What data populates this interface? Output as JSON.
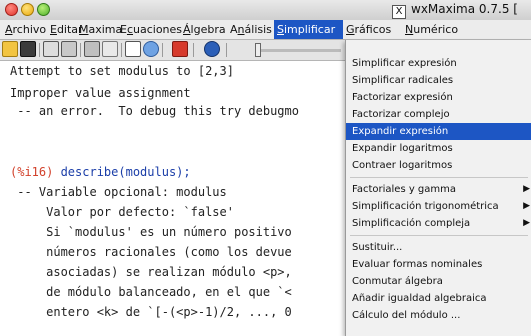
{
  "window": {
    "title": "wxMaxima 0.7.5 [",
    "x_icon": "X"
  },
  "menubar": [
    {
      "label": "Archivo",
      "mn": "A",
      "rest": "rchivo"
    },
    {
      "label": "Editar",
      "mn": "E",
      "rest": "ditar"
    },
    {
      "label": "Maxima",
      "mn": "M",
      "rest": "axima"
    },
    {
      "label": "Ecuaciones",
      "pre": "E",
      "mn": "c",
      "rest": "uaciones"
    },
    {
      "label": "Álgebra",
      "mn": "Á",
      "rest": "lgebra"
    },
    {
      "label": "Análisis",
      "pre": "A",
      "mn": "n",
      "rest": "álisis"
    },
    {
      "label": "Simplificar",
      "mn": "S",
      "rest": "implificar",
      "active": true
    },
    {
      "label": "Gráficos",
      "mn": "G",
      "rest": "ráficos"
    },
    {
      "label": "Numérico",
      "mn": "N",
      "rest": "umérico"
    }
  ],
  "toolbar_icons": [
    "open-folder-icon",
    "save-icon",
    "print-icon",
    "preferences-icon",
    "copy-icon",
    "cut-icon",
    "select-all-icon",
    "settings-icon",
    "stop-icon",
    "info-icon",
    "animation-slider"
  ],
  "worksheet": [
    "Attempt to set modulus to [2,3]",
    "Improper value assignment",
    " -- an error.  To debug this try debugmo",
    "",
    "(%i16) describe(modulus);",
    " -- Variable opcional: modulus",
    "     Valor por defecto: `false'",
    "     Si `modulus' es un número positivo",
    "     números racionales (como los devue",
    "     asociadas) se realizan módulo <p>,",
    "     de módulo balanceado, en el que `<",
    "     entero <k> de `[-(<p>-1)/2, ..., 0"
  ],
  "input_label": "(%i16)",
  "input_command": "describe(modulus);",
  "simplificar_menu": [
    {
      "label": "Simplificar expresión"
    },
    {
      "label": "Simplificar radicales"
    },
    {
      "label": "Factorizar expresión"
    },
    {
      "label": "Factorizar complejo"
    },
    {
      "label": "Expandir expresión",
      "highlighted": true
    },
    {
      "label": "Expandir logaritmos"
    },
    {
      "label": "Contraer logaritmos"
    },
    {
      "separator": true
    },
    {
      "label": "Factoriales y gamma",
      "submenu": true
    },
    {
      "label": "Simplificación trigonométrica",
      "submenu": true
    },
    {
      "label": "Simplificación compleja",
      "submenu": true
    },
    {
      "separator": true
    },
    {
      "label": "Sustituir..."
    },
    {
      "label": "Evaluar formas nominales"
    },
    {
      "label": "Conmutar álgebra"
    },
    {
      "label": "Añadir igualdad algebraica"
    },
    {
      "label": "Cálculo del módulo ..."
    }
  ],
  "colors": {
    "highlight": "#1d56c4",
    "output_label": "#d2412b",
    "input_command": "#1b3ea8"
  }
}
